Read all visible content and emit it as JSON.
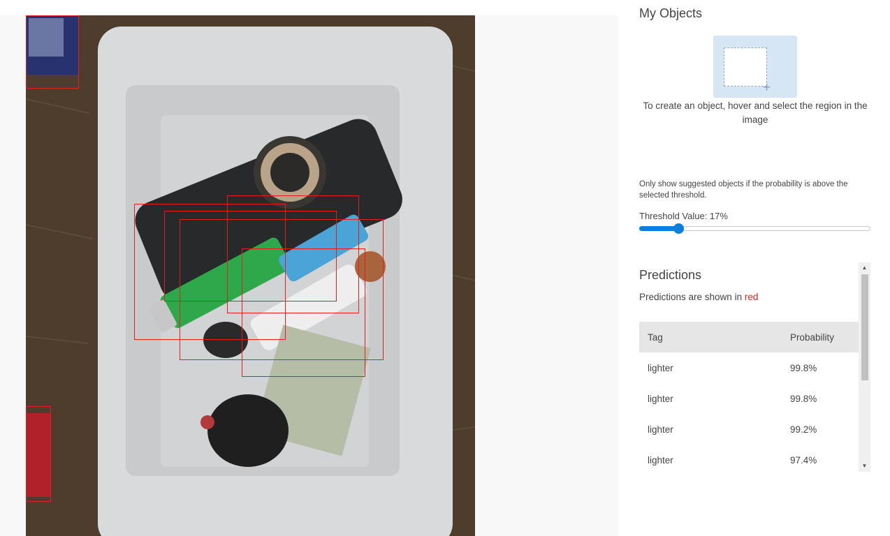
{
  "objects": {
    "title": "My Objects",
    "hint": "To create an object, hover and select the region in the image",
    "placeholder_icon": "plus-icon"
  },
  "threshold": {
    "note": "Only show suggested objects if the probability is above the selected threshold.",
    "label": "Threshold Value: 17%",
    "value_percent": 17
  },
  "predictions": {
    "title": "Predictions",
    "subtitle_prefix": "Predictions are shown in ",
    "subtitle_color_word": "red",
    "columns": [
      "Tag",
      "Probability"
    ],
    "rows": [
      {
        "tag": "lighter",
        "probability": "99.8%"
      },
      {
        "tag": "lighter",
        "probability": "99.8%"
      },
      {
        "tag": "lighter",
        "probability": "99.2%"
      },
      {
        "tag": "lighter",
        "probability": "97.4%"
      }
    ]
  },
  "colors": {
    "prediction_box": "#e01f1f",
    "slider_accent": "#0b7fe0",
    "placeholder_bg": "#d6e6f4"
  }
}
